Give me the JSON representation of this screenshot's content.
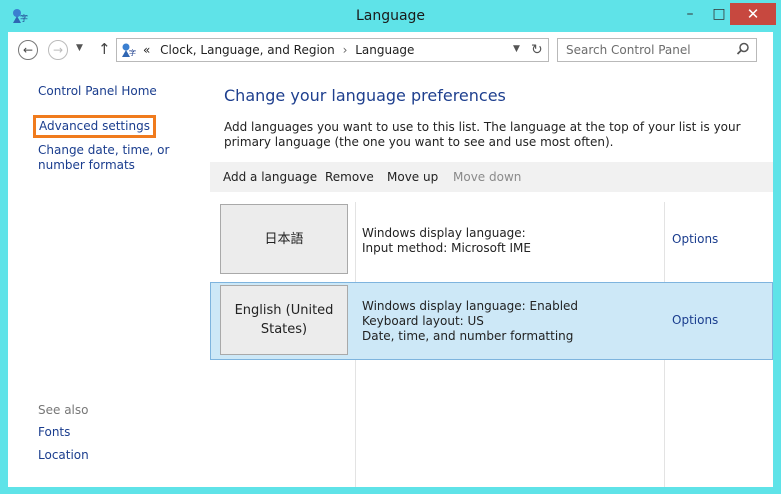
{
  "window": {
    "title": "Language",
    "controls": {
      "minimize": "–",
      "maximize": "□",
      "close": "✕"
    }
  },
  "address": {
    "prefix": "«",
    "crumbs": [
      "Clock, Language, and Region",
      "Language"
    ],
    "separator": "›"
  },
  "search": {
    "placeholder": "Search Control Panel"
  },
  "sidebar": {
    "home": "Control Panel Home",
    "advanced": "Advanced settings",
    "date_time": "Change date, time, or number formats",
    "see_also": "See also",
    "fonts": "Fonts",
    "location": "Location"
  },
  "main": {
    "heading": "Change your language preferences",
    "description": "Add languages you want to use to this list. The language at the top of your list is your primary language (the one you want to see and use most often).",
    "toolbar": {
      "add": "Add a language",
      "remove": "Remove",
      "move_up": "Move up",
      "move_down": "Move down"
    },
    "languages": [
      {
        "name": "日本語",
        "lines": [
          "Windows display language:",
          "Input method: Microsoft IME"
        ],
        "options": "Options"
      },
      {
        "name": "English (United States)",
        "lines": [
          "Windows display language: Enabled",
          "Keyboard layout: US",
          "Date, time, and number formatting"
        ],
        "options": "Options"
      }
    ]
  },
  "colors": {
    "link": "#1a3d8e",
    "heading": "#1e3f8e",
    "frame": "#5fe3e8",
    "selected_row": "#cde8f7",
    "highlight_border": "#f07b1d",
    "close_button": "#c7483f"
  },
  "icons": [
    "control-panel-icon",
    "back-arrow-icon",
    "forward-arrow-icon",
    "chevron-down-icon",
    "up-arrow-icon",
    "refresh-icon",
    "search-icon"
  ]
}
